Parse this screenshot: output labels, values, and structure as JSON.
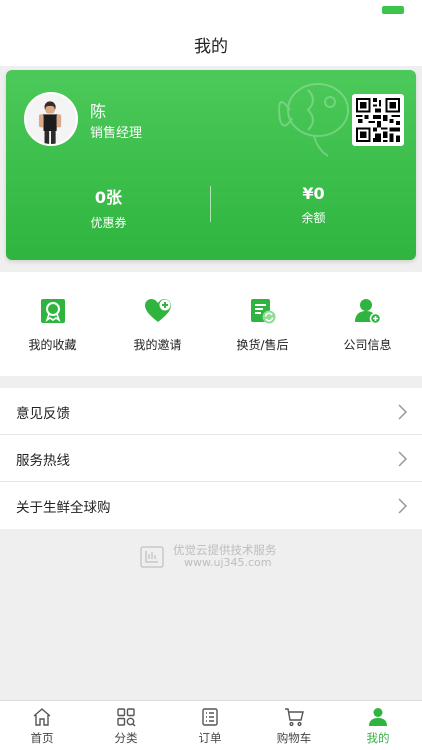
{
  "nav": {
    "title": "我的"
  },
  "profile": {
    "name": "陈",
    "role": "销售经理",
    "coupons": {
      "value": "0张",
      "label": "优惠券"
    },
    "balance": {
      "value": "¥0",
      "label": "余额"
    }
  },
  "quick_actions": [
    {
      "label": "我的收藏",
      "icon": "favorites-badge-icon"
    },
    {
      "label": "我的邀请",
      "icon": "invite-heart-icon"
    },
    {
      "label": "换货/售后",
      "icon": "exchange-icon"
    },
    {
      "label": "公司信息",
      "icon": "company-user-icon"
    }
  ],
  "menu": [
    {
      "label": "意见反馈"
    },
    {
      "label": "服务热线"
    },
    {
      "label": "关于生鲜全球购"
    }
  ],
  "footer": {
    "line1": "优觉云提供技术服务",
    "line2": "www.uj345.com"
  },
  "tabs": [
    {
      "label": "首页",
      "icon": "home-icon",
      "active": false
    },
    {
      "label": "分类",
      "icon": "category-grid-icon",
      "active": false
    },
    {
      "label": "订单",
      "icon": "order-list-icon",
      "active": false
    },
    {
      "label": "购物车",
      "icon": "cart-icon",
      "active": false
    },
    {
      "label": "我的",
      "icon": "user-icon",
      "active": true
    }
  ],
  "colors": {
    "accent": "#2fb53f",
    "accent_light": "#4cc95a",
    "background": "#efefef"
  }
}
